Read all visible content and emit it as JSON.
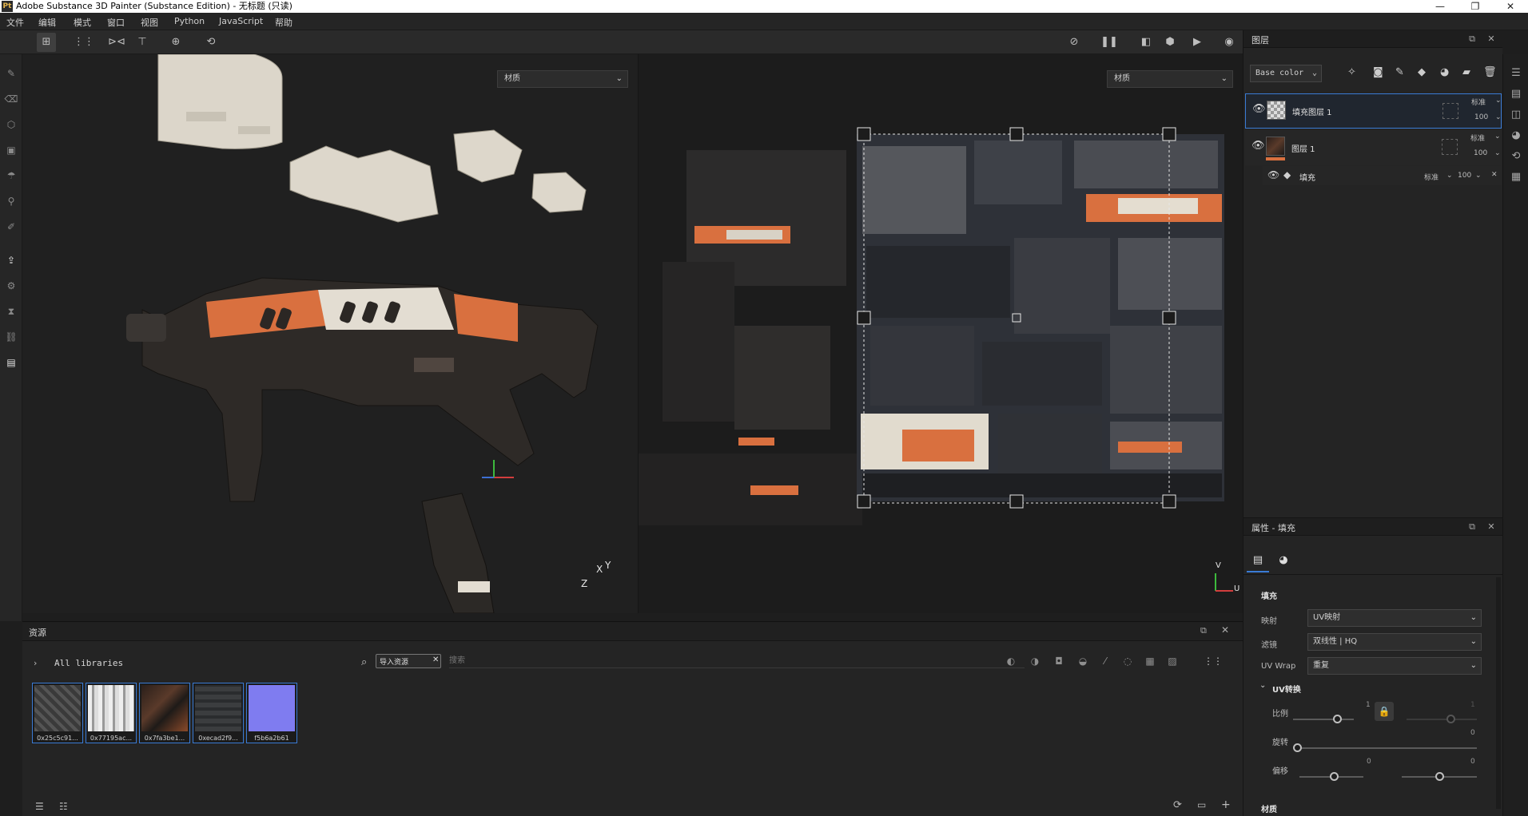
{
  "window": {
    "title": "Adobe Substance 3D Painter (Substance Edition) - 无标题 (只读)",
    "app_icon": "Pt",
    "controls": [
      "—",
      "❐",
      "✕"
    ]
  },
  "menu": [
    "文件",
    "编辑",
    "模式",
    "窗口",
    "视图",
    "Python",
    "JavaScript",
    "帮助"
  ],
  "viewport": {
    "left_dropdown": "材质",
    "right_dropdown": "材质",
    "axis3d": {
      "x": "X",
      "y": "Y",
      "z": "Z"
    },
    "axis2d": {
      "v": "V",
      "u": "U"
    }
  },
  "layers_panel": {
    "title": "图层",
    "channel_select": "Base color",
    "layers": [
      {
        "name": "填充图层 1",
        "blend": "标准",
        "opacity": "100",
        "selected": true
      },
      {
        "name": "图层 1",
        "blend": "标准",
        "opacity": "100",
        "selected": false
      }
    ],
    "effect": {
      "name": "填充",
      "blend": "标准",
      "opacity": "100"
    }
  },
  "properties_panel": {
    "title": "属性 - 填充",
    "section_fill": "填充",
    "projection_label": "映射",
    "projection_value": "UV映射",
    "filter_label": "滤镜",
    "filter_value": "双线性 | HQ",
    "uvwrap_label": "UV Wrap",
    "uvwrap_value": "重复",
    "uv_transform_label": "UV转换",
    "scale_label": "比例",
    "scale_value": "1",
    "scale_value2": "1",
    "rotation_label": "旋转",
    "rotation_value": "0",
    "offset_label": "偏移",
    "offset_value_u": "0",
    "offset_value_v": "0",
    "material_label": "材质"
  },
  "assets_panel": {
    "title": "资源",
    "library": "All libraries",
    "filter_chip": "导入资源",
    "search_placeholder": "搜索",
    "items": [
      {
        "name": "0x25c5c91...",
        "color": "#4a4a4a"
      },
      {
        "name": "0x77195ac...",
        "color": "#d8d8d8"
      },
      {
        "name": "0x7fa3be1...",
        "color": "#3a2a22"
      },
      {
        "name": "0xecad2f9...",
        "color": "#3b3d3f"
      },
      {
        "name": "f5b6a2b61",
        "color": "#7f7cf0"
      }
    ]
  },
  "colors": {
    "accent": "#3a7bd5",
    "orange": "#d9703f",
    "background": "#1e1e1e"
  }
}
